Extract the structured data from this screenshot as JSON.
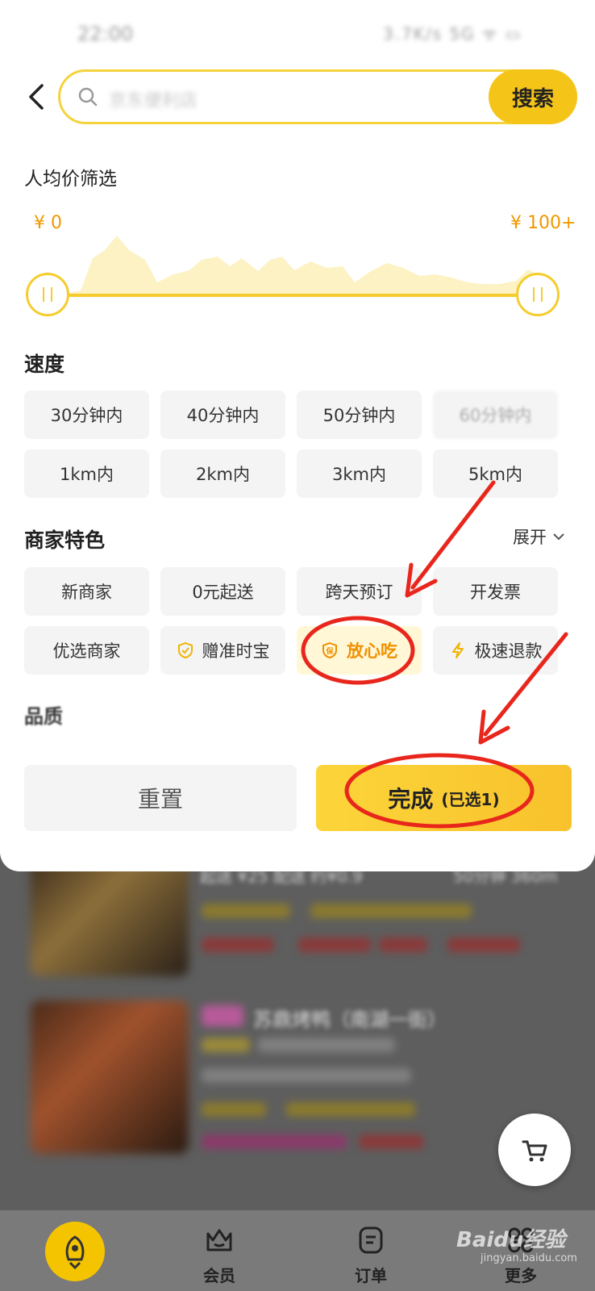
{
  "search": {
    "placeholder": "京东便利店",
    "button_label": "搜索"
  },
  "status_bar": {
    "time": "22:00",
    "indicators": "3.7K/s 5G ᯤ ▭"
  },
  "price_filter": {
    "title": "人均价筛选",
    "min_label": "¥ 0",
    "max_label": "¥ 100+",
    "min_value": 0,
    "max_value": 100
  },
  "speed": {
    "title": "速度",
    "chips": [
      "30分钟内",
      "40分钟内",
      "50分钟内",
      "60分钟内",
      "1km内",
      "2km内",
      "3km内",
      "5km内"
    ]
  },
  "features": {
    "title": "商家特色",
    "expand_label": "展开",
    "chips": [
      "新商家",
      "0元起送",
      "跨天预订",
      "开发票",
      "优选商家",
      "赠准时宝",
      "放心吃",
      "极速退款"
    ],
    "selected": "放心吃"
  },
  "quality": {
    "title": "品质"
  },
  "actions": {
    "reset_label": "重置",
    "done_label": "完成",
    "done_count": "(已选1)"
  },
  "background_list": {
    "line1": "起送 ¥25  配送 约¥0.9",
    "line1_right": "50分钟  360m",
    "line2_title": "苏鼎烤鸭（南湖一街）"
  },
  "tabbar": {
    "tabs": [
      "会员",
      "订单",
      "更多"
    ]
  },
  "watermark": {
    "brand": "Baidu经验",
    "url": "jingyan.baidu.com"
  },
  "colors": {
    "accent": "#f5c418",
    "price": "#f09800",
    "annotation": "#e8261c"
  }
}
